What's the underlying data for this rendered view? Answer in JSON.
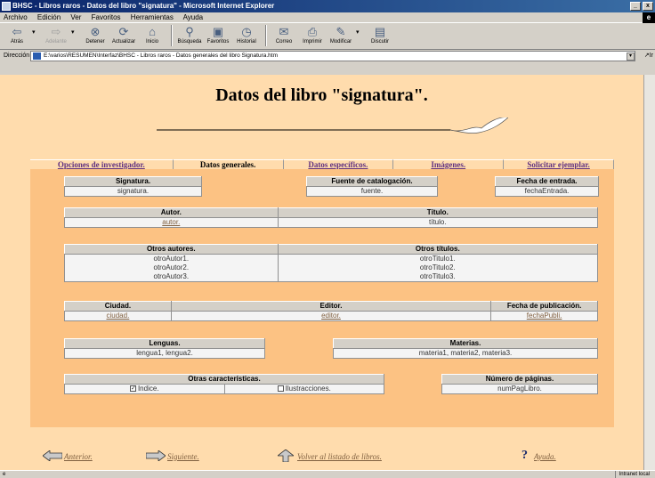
{
  "window": {
    "title": "BHSC - Libros raros - Datos del libro \"signatura\" - Microsoft Internet Explorer",
    "min": "_",
    "close": "x"
  },
  "menu": [
    "Archivo",
    "Edición",
    "Ver",
    "Favoritos",
    "Herramientas",
    "Ayuda"
  ],
  "toolbar": {
    "back": "Atrás",
    "forward": "Adelante",
    "stop": "Detener",
    "refresh": "Actualizar",
    "home": "Inicio",
    "search": "Búsqueda",
    "favorites": "Favoritos",
    "history": "Historial",
    "mail": "Correo",
    "print": "Imprimir",
    "edit": "Modificar",
    "discuss": "Discutir"
  },
  "address": {
    "label": "Dirección",
    "value": "E:\\varios\\RESUMEN\\Interfaz\\BHSC - Libros raros - Datos generales del libro Signatura.htm",
    "go": "Ir"
  },
  "page": {
    "title": "Datos del libro \"signatura\"."
  },
  "tabs": [
    "Opciones de investigador.",
    "Datos generales.",
    "Datos específicos.",
    "Imágenes.",
    "Solicitar ejemplar."
  ],
  "active_tab": "Datos generales.",
  "groups": {
    "signatura": {
      "label": "Signatura.",
      "value": "signatura."
    },
    "fuente": {
      "label": "Fuente de catalogación.",
      "value": "fuente."
    },
    "fecha_entrada": {
      "label": "Fecha de entrada.",
      "value": "fechaEntrada."
    },
    "autor": {
      "label": "Autor.",
      "value": "autor."
    },
    "titulo": {
      "label": "Título.",
      "value": "título."
    },
    "otros_autores": {
      "label": "Otros autores.",
      "values": [
        "otroAutor1.",
        "otroAutor2.",
        "otroAutor3."
      ]
    },
    "otros_titulos": {
      "label": "Otros títulos.",
      "values": [
        "otroTitulo1.",
        "otroTitulo2.",
        "otroTitulo3."
      ]
    },
    "ciudad": {
      "label": "Ciudad.",
      "value": "ciudad."
    },
    "editor": {
      "label": "Editor.",
      "value": "editor."
    },
    "fecha_pub": {
      "label": "Fecha de publicación.",
      "value": "fechaPubli."
    },
    "lenguas": {
      "label": "Lenguas.",
      "value": "lengua1, lengua2."
    },
    "materias": {
      "label": "Materias.",
      "value": "materia1, materia2, materia3."
    },
    "otras": {
      "label": "Otras características.",
      "indice": "Indice.",
      "ilustraciones": "Ilustracciones."
    },
    "paginas": {
      "label": "Número de páginas.",
      "value": "numPagLibro."
    }
  },
  "footer": {
    "prev": "Anterior.",
    "next": "Siguiente.",
    "back_list": "Volver al listado de libros.",
    "help": "Ayuda."
  },
  "status": {
    "right": "Intranet local"
  },
  "colors": {
    "page_bg": "#ffdcad",
    "panel_bg": "#fcc283",
    "header_bg": "#d4d0c8"
  }
}
